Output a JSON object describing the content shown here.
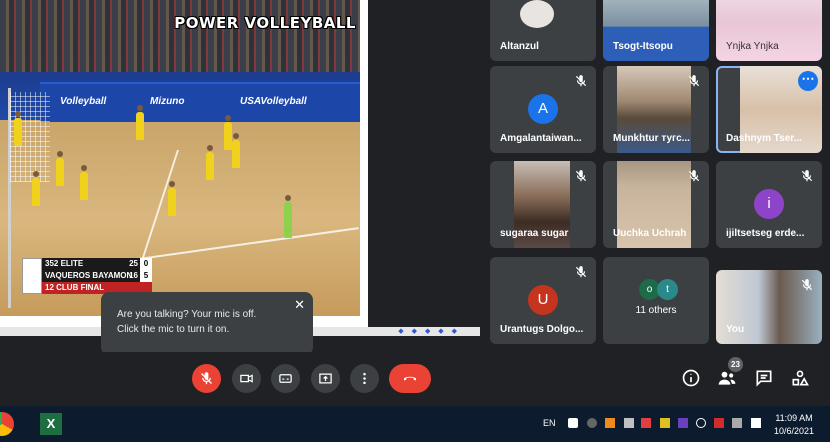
{
  "presentation": {
    "brand": "POWER VOLLEYBALL",
    "banner": [
      "Volleyball",
      "Mizuno",
      "USAVolleyball"
    ],
    "scoreboard": {
      "team1": "352 ELITE",
      "team1_points": "25",
      "team1_sets": "0",
      "team2": "VAQUEROS BAYAMON",
      "team2_points": "16",
      "team2_sets": "5",
      "footer": "12 CLUB FINAL"
    }
  },
  "participants": [
    {
      "name": "Altanzul",
      "type": "photo"
    },
    {
      "name": "Tsogt-Itsopu",
      "type": "photo"
    },
    {
      "name": "Ynjka Ynjka",
      "type": "photo"
    },
    {
      "name": "Amgalantaiwan...",
      "initial": "A",
      "color": "#1a73e8",
      "muted": true
    },
    {
      "name": "Munkhtur тугс...",
      "type": "photo",
      "muted": true
    },
    {
      "name": "Dashnym Tser...",
      "type": "photo",
      "active": true
    },
    {
      "name": "sugaraa sugar",
      "type": "photo",
      "muted": true
    },
    {
      "name": "Uuchka Uchrah",
      "type": "photo",
      "muted": true
    },
    {
      "name": "ijiltsetseg erde...",
      "initial": "i",
      "color": "#8e44c9",
      "muted": true
    },
    {
      "name": "Urantugs Dolgo...",
      "initial": "U",
      "color": "#c5341f",
      "muted": true
    },
    {
      "name": "11 others",
      "initials": [
        "o",
        "t"
      ]
    },
    {
      "name": "You",
      "type": "photo",
      "muted": true
    }
  ],
  "tooltip": {
    "line1": "Are you talking? Your mic is off.",
    "line2": "Click the mic to turn it on.",
    "close": "✕"
  },
  "controls": {
    "people_count": "23"
  },
  "taskbar": {
    "language": "EN",
    "time": "11:09 AM",
    "date": "10/6/2021"
  },
  "colors": {
    "background": "#202124",
    "tile": "#3c4043",
    "danger": "#ea4335",
    "accent": "#1a73e8"
  }
}
